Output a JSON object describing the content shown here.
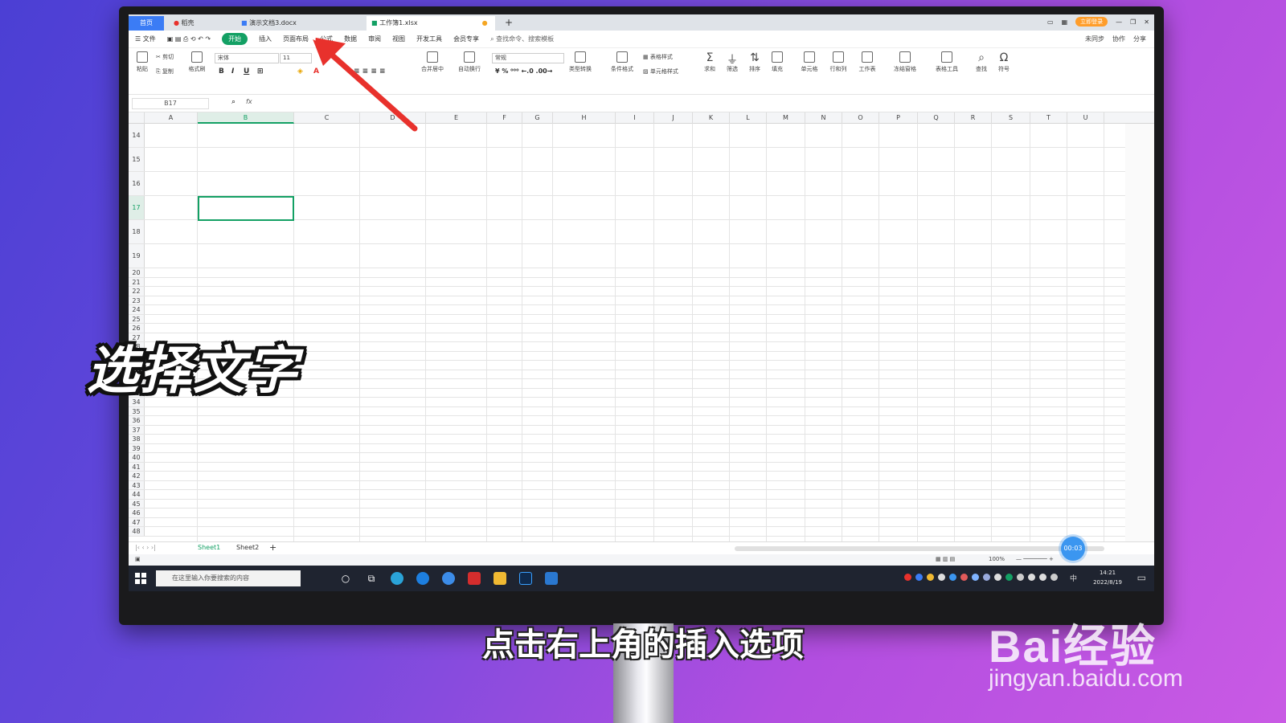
{
  "tabs": [
    {
      "label": "首页"
    },
    {
      "label": "稻壳"
    },
    {
      "label": "演示文档3.docx"
    },
    {
      "label": "工作簿1.xlsx"
    }
  ],
  "tabbar_right": {
    "login": "立即登录"
  },
  "menu": {
    "file": "文件",
    "start": "开始",
    "insert": "插入",
    "items": [
      "页面布局",
      "公式",
      "数据",
      "审阅",
      "视图",
      "开发工具",
      "会员专享"
    ],
    "search": "查找命令、搜索模板",
    "right": [
      "未同步",
      "协作",
      "分享"
    ]
  },
  "ribbon": {
    "paste": "粘贴",
    "cut": "剪切",
    "copy": "复制",
    "format_painter": "格式刷",
    "font": "宋体",
    "size": "11",
    "merge_center": "合并居中",
    "auto_wrap": "自动换行",
    "number_format": "常规",
    "type_convert": "类型转换",
    "cond_format": "条件格式",
    "table_style": "表格样式",
    "cell_style": "单元格样式",
    "sum": "求和",
    "filter": "筛选",
    "sort": "排序",
    "fill": "填充",
    "cell": "单元格",
    "row_col": "行和列",
    "worksheet": "工作表",
    "freeze": "冻结窗格",
    "table_tools": "表格工具",
    "find": "查找",
    "symbol": "符号"
  },
  "formula_bar": {
    "name_box": "B17",
    "fx": "fx"
  },
  "columns": [
    "A",
    "B",
    "C",
    "D",
    "E",
    "F",
    "G",
    "H",
    "I",
    "J",
    "K",
    "L",
    "M",
    "N",
    "O",
    "P",
    "Q",
    "R",
    "S",
    "T",
    "U"
  ],
  "rows": [
    "14",
    "15",
    "16",
    "17",
    "18",
    "19",
    "20",
    "21",
    "22",
    "23",
    "24",
    "25",
    "26",
    "27",
    "28",
    "29",
    "30",
    "31",
    "32",
    "33",
    "34",
    "35",
    "36",
    "37",
    "38",
    "39",
    "40",
    "41",
    "42",
    "43",
    "44",
    "45",
    "46",
    "47",
    "48"
  ],
  "sheets": [
    "Sheet1",
    "Sheet2"
  ],
  "status": {
    "zoom": "100%"
  },
  "taskbar": {
    "search_placeholder": "在这里输入你要搜索的内容",
    "time": "14:21",
    "date": "2022/8/19",
    "ime": "中"
  },
  "timer": "00:03",
  "overlay_title": "选择文字",
  "caption": "点击右上角的插入选项",
  "watermark": {
    "brand": "Bai经验",
    "url": "jingyan.baidu.com"
  },
  "colors": {
    "accent": "#13a064",
    "tab_home": "#3b7cf5",
    "arrow": "#e8312c"
  }
}
